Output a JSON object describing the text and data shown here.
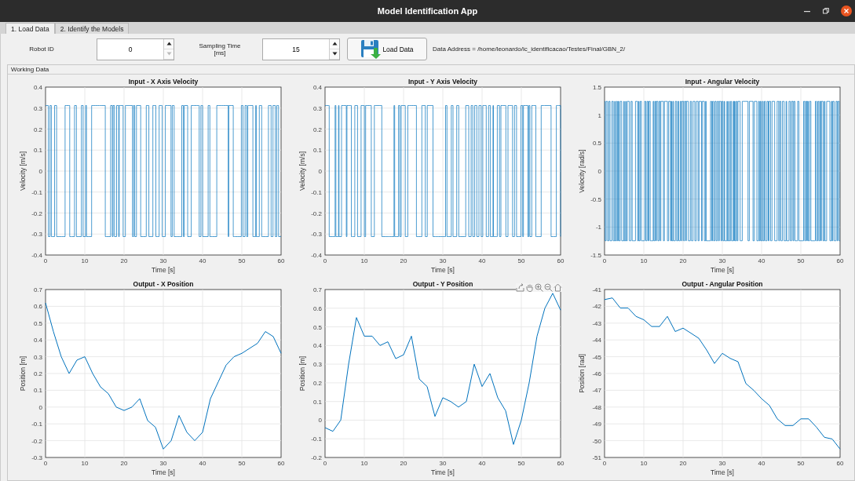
{
  "window": {
    "title": "Model Identification App"
  },
  "tabs": [
    {
      "label": "1. Load Data",
      "selected": true
    },
    {
      "label": "2. Identify the Models",
      "selected": false
    }
  ],
  "controls": {
    "robot_id": {
      "label": "Robot ID",
      "value": "0",
      "up_disabled": false,
      "down_disabled": true
    },
    "sampling_time": {
      "label": "Sampling Time [ms]",
      "value": "15",
      "up_disabled": false,
      "down_disabled": false
    },
    "load_button": {
      "label": "Load Data"
    },
    "data_address": "Data Address = /home/leonardo/ic_identificacao/Testes/Final/GBN_2/"
  },
  "panel": {
    "title": "Working Data"
  },
  "plots": [
    {
      "kind": "waveform",
      "toolbar_visible": false,
      "title": "Input  - X Axis Velocity",
      "xlabel": "Time [s]",
      "ylabel": "Velocity [m/s]",
      "xticks": [
        "0",
        "10",
        "20",
        "30",
        "40",
        "50",
        "60"
      ],
      "yticks": [
        "0.4",
        "0.3",
        "0.2",
        "0.1",
        "0",
        "-0.1",
        "-0.2",
        "-0.3",
        "-0.4"
      ]
    },
    {
      "kind": "waveform",
      "toolbar_visible": false,
      "title": "Input  - Y Axis Velocity",
      "xlabel": "Time [s]",
      "ylabel": "Velocity [m/s]",
      "xticks": [
        "0",
        "10",
        "20",
        "30",
        "40",
        "50",
        "60"
      ],
      "yticks": [
        "0.4",
        "0.3",
        "0.2",
        "0.1",
        "0",
        "-0.1",
        "-0.2",
        "-0.3",
        "-0.4"
      ]
    },
    {
      "kind": "waveform",
      "toolbar_visible": false,
      "title": "Input  - Angular Velocity",
      "xlabel": "Time [s]",
      "ylabel": "Velocity [rad/s]",
      "xticks": [
        "0",
        "10",
        "20",
        "30",
        "40",
        "50",
        "60"
      ],
      "yticks": [
        "1.5",
        "1",
        "0.5",
        "0",
        "-0.5",
        "-1",
        "-1.5"
      ]
    },
    {
      "kind": "chart",
      "toolbar_visible": false,
      "chart_data": {
        "type": "line",
        "title": "Output - X Position",
        "xlabel": "Time [s]",
        "ylabel": "Position [m]",
        "grid": true,
        "xlim": [
          0,
          60
        ],
        "ylim": [
          -0.3,
          0.7
        ],
        "xticks": [
          0,
          10,
          20,
          30,
          40,
          50,
          60
        ],
        "yticks": [
          -0.3,
          -0.2,
          -0.1,
          0,
          0.1,
          0.2,
          0.3,
          0.4,
          0.5,
          0.6,
          0.7
        ],
        "x": [
          0,
          2,
          4,
          6,
          8,
          10,
          12,
          14,
          16,
          18,
          20,
          22,
          24,
          26,
          28,
          30,
          32,
          34,
          36,
          38,
          40,
          42,
          44,
          46,
          48,
          50,
          52,
          54,
          56,
          58,
          60
        ],
        "series": [
          {
            "color": "#0072bd",
            "values": [
              0.62,
              0.45,
              0.3,
              0.2,
              0.28,
              0.3,
              0.2,
              0.12,
              0.08,
              0.0,
              -0.02,
              0.0,
              0.05,
              -0.08,
              -0.12,
              -0.25,
              -0.2,
              -0.05,
              -0.15,
              -0.2,
              -0.15,
              0.05,
              0.15,
              0.25,
              0.3,
              0.32,
              0.35,
              0.38,
              0.45,
              0.42,
              0.32
            ]
          }
        ]
      }
    },
    {
      "kind": "chart",
      "toolbar_visible": true,
      "chart_data": {
        "type": "line",
        "title": "Output - Y Position",
        "xlabel": "Time [s]",
        "ylabel": "Position [m]",
        "grid": true,
        "xlim": [
          0,
          60
        ],
        "ylim": [
          -0.2,
          0.7
        ],
        "xticks": [
          0,
          10,
          20,
          30,
          40,
          50,
          60
        ],
        "yticks": [
          -0.2,
          -0.1,
          0,
          0.1,
          0.2,
          0.3,
          0.4,
          0.5,
          0.6,
          0.7
        ],
        "x": [
          0,
          2,
          4,
          6,
          8,
          10,
          12,
          14,
          16,
          18,
          20,
          22,
          24,
          26,
          28,
          30,
          32,
          34,
          36,
          38,
          40,
          42,
          44,
          46,
          48,
          50,
          52,
          54,
          56,
          58,
          60
        ],
        "series": [
          {
            "color": "#0072bd",
            "values": [
              -0.04,
              -0.06,
              0.0,
              0.3,
              0.55,
              0.45,
              0.45,
              0.4,
              0.42,
              0.33,
              0.35,
              0.45,
              0.22,
              0.18,
              0.02,
              0.12,
              0.1,
              0.07,
              0.1,
              0.3,
              0.18,
              0.25,
              0.12,
              0.05,
              -0.13,
              0.0,
              0.2,
              0.45,
              0.6,
              0.68,
              0.59
            ]
          }
        ]
      }
    },
    {
      "kind": "chart",
      "toolbar_visible": false,
      "chart_data": {
        "type": "line",
        "title": "Output - Angular Position",
        "xlabel": "Time [s]",
        "ylabel": "Position [rad]",
        "grid": true,
        "xlim": [
          0,
          60
        ],
        "ylim": [
          -51,
          -41
        ],
        "xticks": [
          0,
          10,
          20,
          30,
          40,
          50,
          60
        ],
        "yticks": [
          -51,
          -50,
          -49,
          -48,
          -47,
          -46,
          -45,
          -44,
          -43,
          -42,
          -41
        ],
        "x": [
          0,
          2,
          4,
          6,
          8,
          10,
          12,
          14,
          16,
          18,
          20,
          22,
          24,
          26,
          28,
          30,
          32,
          34,
          36,
          38,
          40,
          42,
          44,
          46,
          48,
          50,
          52,
          54,
          56,
          58,
          60
        ],
        "series": [
          {
            "color": "#0072bd",
            "values": [
              -41.6,
              -41.5,
              -42.1,
              -42.1,
              -42.6,
              -42.8,
              -43.2,
              -43.2,
              -42.6,
              -43.5,
              -43.3,
              -43.6,
              -43.9,
              -44.6,
              -45.4,
              -44.8,
              -45.1,
              -45.3,
              -46.6,
              -47.0,
              -47.5,
              -47.9,
              -48.7,
              -49.1,
              -49.1,
              -48.7,
              -48.7,
              -49.2,
              -49.8,
              -49.9,
              -50.5
            ]
          }
        ]
      }
    }
  ]
}
